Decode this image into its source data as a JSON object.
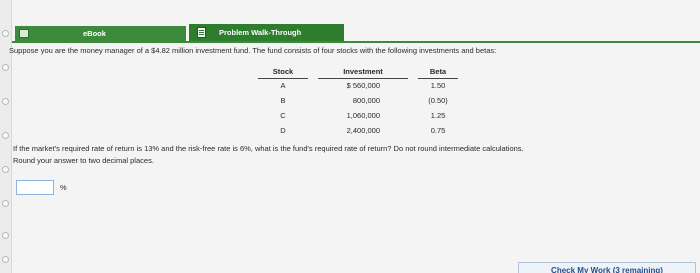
{
  "tabs": {
    "ebook_label": "eBook",
    "walkthrough_label": "Problem Walk-Through"
  },
  "problem": {
    "intro": "Suppose you are the money manager of a $4.82 million investment fund. The fund consists of four stocks with the following investments and betas:",
    "table": {
      "headers": [
        "Stock",
        "Investment",
        "Beta"
      ],
      "rows": [
        {
          "stock": "A",
          "investment": "$  560,000",
          "beta": "1.50"
        },
        {
          "stock": "B",
          "investment": "800,000",
          "beta": "(0.50)"
        },
        {
          "stock": "C",
          "investment": "1,060,000",
          "beta": "1.25"
        },
        {
          "stock": "D",
          "investment": "2,400,000",
          "beta": "0.75"
        }
      ]
    },
    "question_line1": "If the market's required rate of return is 13% and the risk-free rate is 6%, what is the fund's required rate of return? Do not round intermediate calculations.",
    "question_line2": "Round your answer to two decimal places.",
    "answer_value": "",
    "answer_unit": "%"
  },
  "footer": {
    "check_label": "Check My Work (3 remaining)"
  },
  "colors": {
    "tab_green": "#3d8a3d",
    "tab_green_dark": "#2e7d2e",
    "input_border": "#8bb4de",
    "link_blue": "#1d4f8a"
  }
}
